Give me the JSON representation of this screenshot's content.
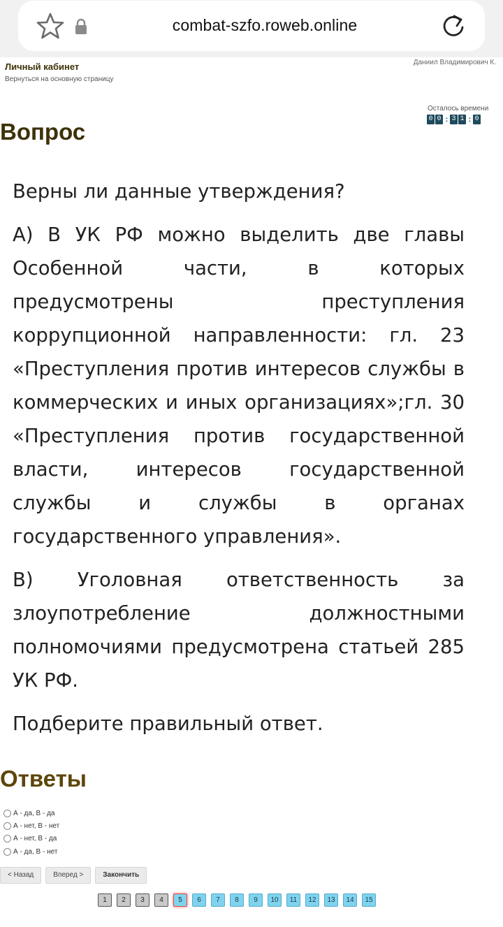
{
  "browser": {
    "url": "combat-szfo.roweb.online"
  },
  "header": {
    "cabinet_title": "Личный кабинет",
    "back_link": "Вернуться на основную страницу",
    "user_name": "Даниил Владимирович К."
  },
  "timer": {
    "label": "Осталось времени",
    "digits": [
      "0",
      "0",
      "3",
      "1",
      "0"
    ]
  },
  "question": {
    "heading": "Вопрос",
    "paragraphs": [
      "Верны ли данные утверждения?",
      "А) В УК РФ можно выделить две главы Особенной части, в которых предусмотрены преступления коррупционной направленности: гл. 23 «Преступления против интересов службы в коммерческих и иных организациях»;гл. 30 «Преступления против государственной власти, интересов государственной службы и службы в органах государственного управления».",
      "В) Уголовная ответственность за злоупотребление должностными полномочиями предусмотрена статьей 285 УК РФ.",
      "Подберите правильный ответ."
    ]
  },
  "answers": {
    "heading": "Ответы",
    "options": [
      "А - да, В - да",
      "А - нет, В - нет",
      "А - нет, В - да",
      "А - да, В - нет"
    ]
  },
  "nav": {
    "back": "< Назад",
    "forward": "Вперед >",
    "finish": "Закончить"
  },
  "pagination": {
    "current": 5,
    "pages": [
      "1",
      "2",
      "3",
      "4",
      "5",
      "6",
      "7",
      "8",
      "9",
      "10",
      "11",
      "12",
      "13",
      "14",
      "15"
    ]
  },
  "colors": {
    "heading": "#3d3208",
    "timer_digit": "#1e4a5c",
    "page_pending": "#7fd3ef",
    "page_done": "#c9c9c9",
    "page_current_border": "#e04848"
  }
}
